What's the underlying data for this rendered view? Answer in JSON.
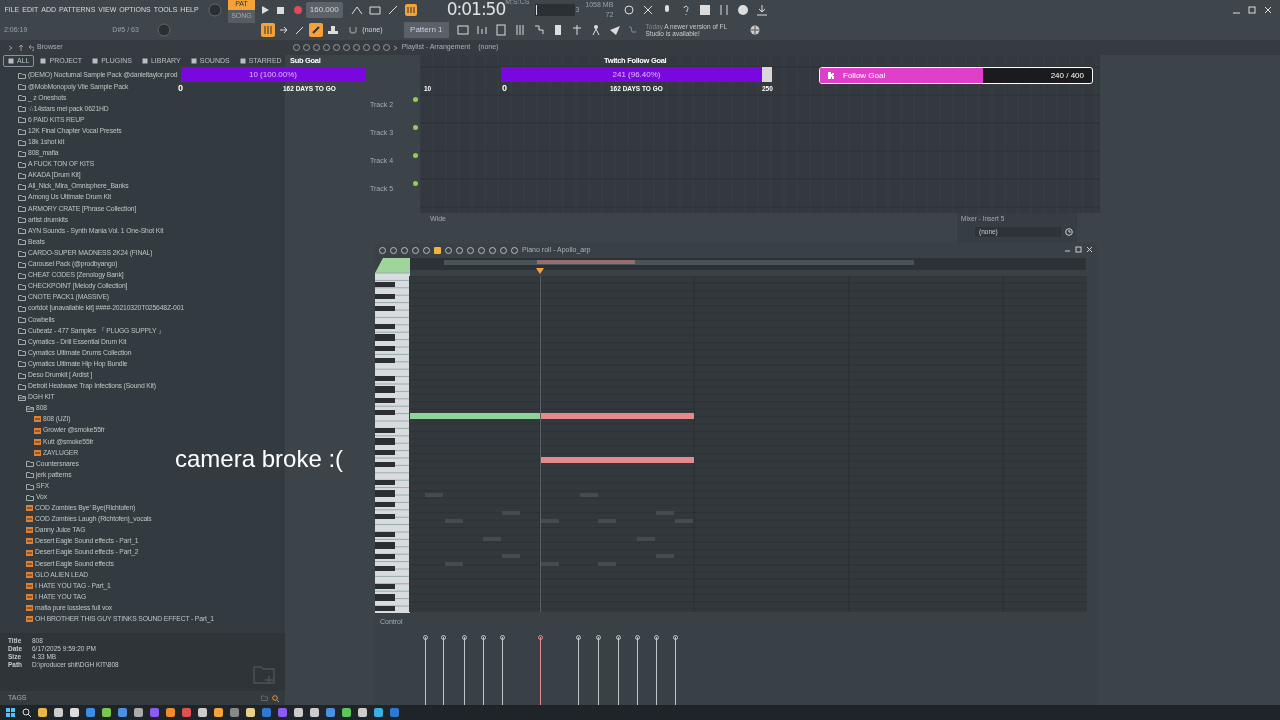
{
  "menu": [
    "FILE",
    "EDIT",
    "ADD",
    "PATTERNS",
    "VIEW",
    "OPTIONS",
    "TOOLS",
    "HELP"
  ],
  "transport": {
    "modes": [
      {
        "label": "PAT",
        "selected": true
      },
      {
        "label": "SONG",
        "selected": false
      }
    ],
    "tempo": "160.000",
    "time": "0:01:50",
    "time_unit": "M:S:CS",
    "counter": "3",
    "memory": "1058 MB",
    "polyphony": "72",
    "hint_time": "2:06:19",
    "hint_note": "D#5 / 63",
    "snap": "(none)",
    "pattern": "Pattern 1"
  },
  "news": {
    "date": "Today",
    "message": "A newer version of FL Studio is available!"
  },
  "browser": {
    "title": "Browser",
    "tabs": [
      {
        "label": "ALL",
        "selected": true
      },
      {
        "label": "PROJECT",
        "selected": false
      },
      {
        "label": "PLUGINS",
        "selected": false
      },
      {
        "label": "LIBRARY",
        "selected": false
      },
      {
        "label": "SOUNDS",
        "selected": false
      },
      {
        "label": "STARRED",
        "selected": false
      }
    ],
    "items": [
      {
        "kind": "folder",
        "label": "(DEMO) Nocturnal Sample Pack @danieltaylor.prod",
        "expanded": false
      },
      {
        "kind": "folder",
        "label": "@MobMonopoly Vile Sample Pack",
        "expanded": false
      },
      {
        "kind": "folder",
        "label": "_ z Oneshots",
        "expanded": false
      },
      {
        "kind": "folder",
        "label": "☆14stars mel pack 0621HD",
        "expanded": false
      },
      {
        "kind": "folder",
        "label": "6 PAID KITS REUP",
        "expanded": false
      },
      {
        "kind": "folder",
        "label": "12K Final Chapter Vocal Presets",
        "expanded": false
      },
      {
        "kind": "folder",
        "label": "18k 1shot kit",
        "expanded": false
      },
      {
        "kind": "folder",
        "label": "808_mafia",
        "expanded": false
      },
      {
        "kind": "folder",
        "label": "A FUCK TON OF KITS",
        "expanded": false
      },
      {
        "kind": "folder",
        "label": "AKADA [Drum Kit]",
        "expanded": false
      },
      {
        "kind": "folder",
        "label": "All_Nick_Mira_Omnisphere_Banks",
        "expanded": false
      },
      {
        "kind": "folder",
        "label": "Among Us Ultimate Drum Kit",
        "expanded": false
      },
      {
        "kind": "folder",
        "label": "ARMORY CRATE [Phrase Collection]",
        "expanded": false
      },
      {
        "kind": "folder",
        "label": "artist drumkits",
        "expanded": false
      },
      {
        "kind": "folder",
        "label": "AYN Sounds - Synth Mania Vol. 1 One-Shot Kit",
        "expanded": false
      },
      {
        "kind": "folder",
        "label": "Beats",
        "expanded": false
      },
      {
        "kind": "folder",
        "label": "CARDO-SUPER MADNESS 2K24 (FINAL)",
        "expanded": false
      },
      {
        "kind": "folder",
        "label": "Carousel Pack (@prodbyango)",
        "expanded": false
      },
      {
        "kind": "folder",
        "label": "CHEAT CODES [Zenology Bank]",
        "expanded": false
      },
      {
        "kind": "folder",
        "label": "CHECKPOINT [Melody Collection]",
        "expanded": false
      },
      {
        "kind": "folder",
        "label": "CNOTE PACK1 (MASSIVE)",
        "expanded": false
      },
      {
        "kind": "folder",
        "label": "cortdot [unavailable kit] ####-20210320T025648Z-001",
        "expanded": false
      },
      {
        "kind": "folder",
        "label": "Cowbells",
        "expanded": false
      },
      {
        "kind": "folder",
        "label": "Cubeatz - 477 Samples 『 PLUGG SUPPLY 』",
        "expanded": false
      },
      {
        "kind": "folder",
        "label": "Cymatics - Drill Essential Drum Kit",
        "expanded": false
      },
      {
        "kind": "folder",
        "label": "Cymatics Ultimate Drums Collection",
        "expanded": false
      },
      {
        "kind": "folder",
        "label": "Cymatics Ultimate Hip Hop Bundle",
        "expanded": false
      },
      {
        "kind": "folder",
        "label": "Deso Drumkit [ Ardist ]",
        "expanded": false
      },
      {
        "kind": "folder",
        "label": "Detroit Heatwave Trap Infections (Sound Kit)",
        "expanded": false
      },
      {
        "kind": "folder",
        "label": "DGH KIT",
        "expanded": true,
        "children": [
          {
            "kind": "folder",
            "label": "808",
            "expanded": true,
            "children": [
              {
                "kind": "file",
                "label": "808 (UZI)"
              },
              {
                "kind": "file",
                "label": "Growler @smoke55fr"
              },
              {
                "kind": "file",
                "label": "Kutt @smoke55fr"
              },
              {
                "kind": "file",
                "label": "ZAYLUGER"
              }
            ]
          },
          {
            "kind": "folder",
            "label": "Countersnares",
            "expanded": false
          },
          {
            "kind": "folder",
            "label": "jerk patterns",
            "expanded": false
          },
          {
            "kind": "folder",
            "label": "SFX",
            "expanded": false
          },
          {
            "kind": "folder",
            "label": "Vox",
            "expanded": false
          },
          {
            "kind": "file",
            "label": "COD Zombies Bye' Bye(Richtofen)"
          },
          {
            "kind": "file",
            "label": "COD Zombies Laugh (Richtofen)_vocals"
          },
          {
            "kind": "file",
            "label": "Danny Juice TAG"
          },
          {
            "kind": "file",
            "label": "Desert Eagle Sound effects - Part_1"
          },
          {
            "kind": "file",
            "label": "Desert Eagle Sound effects - Part_2"
          },
          {
            "kind": "file",
            "label": "Desert Eagle Sound effects"
          },
          {
            "kind": "file",
            "label": "GLO ALIEN LEAD"
          },
          {
            "kind": "file",
            "label": "I HATE YOU TAG - Part_1"
          },
          {
            "kind": "file",
            "label": "I HATE YOU TAG"
          },
          {
            "kind": "file",
            "label": "mafia pure lossless full vox"
          },
          {
            "kind": "file",
            "label": "OH BROTHER THIS GUY STINKS SOUND EFFECT - Part_1"
          }
        ]
      }
    ],
    "info": [
      {
        "label": "Title",
        "value": "808"
      },
      {
        "label": "Date",
        "value": "6/17/2025 9:59:20 PM"
      },
      {
        "label": "Size",
        "value": "4.33 MB"
      },
      {
        "label": "Path",
        "value": "D:\\producer shit\\DGH KIT\\808"
      }
    ],
    "tags_label": "TAGS"
  },
  "playlist": {
    "title": "Playlist - Arrangement",
    "breadcrumb": "(none)",
    "tracks": [
      "Track 2",
      "Track 3",
      "Track 4",
      "Track 5"
    ],
    "view": "Wide"
  },
  "mixer": {
    "title": "Mixer - Insert 5",
    "slot": "(none)"
  },
  "piano_roll": {
    "title": "Piano roll - Apollo_arp",
    "control_label": "Control"
  },
  "goals": [
    {
      "kind": "bar",
      "title": "Sub Goal",
      "progress": "10 (100.00%)",
      "level": 1,
      "start": "0",
      "days": "162 DAYS TO GO",
      "target": "10"
    },
    {
      "kind": "bar",
      "title": "Twitch Follow Goal",
      "progress": "241 (96.40%)",
      "level": 0.964,
      "start": "0",
      "days": "162 DAYS TO GO",
      "target": "250"
    },
    {
      "kind": "pill",
      "title": "Follow Goal",
      "count": "240 / 400",
      "level": 0.6
    }
  ],
  "caption": "camera broke :("
}
